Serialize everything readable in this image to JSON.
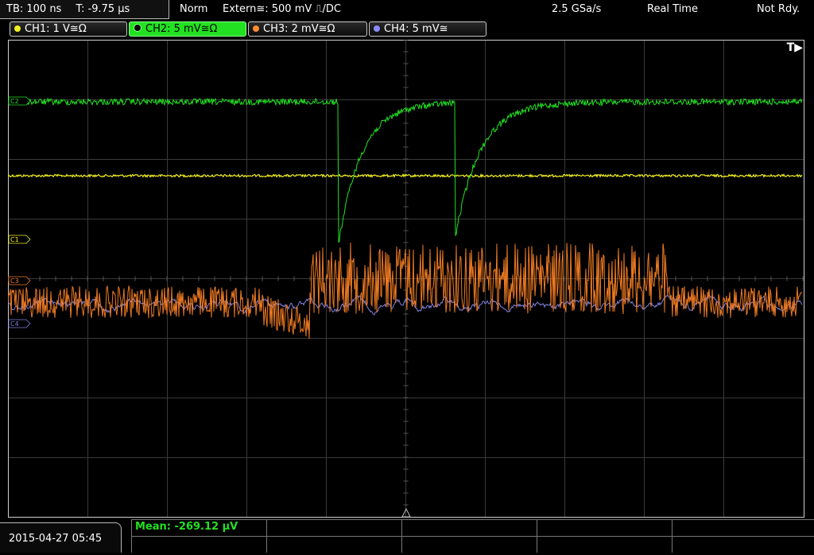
{
  "status_bar": {
    "timebase": "TB: 100 ns",
    "trigger_time": "T: -9.75 µs",
    "trigger_mode": "Norm",
    "trigger_source": "Extern≅: 500 mV ⎍/DC",
    "sample_rate": "2.5 GSa/s",
    "acq_mode": "Real Time",
    "state": "Not Rdy."
  },
  "channels": [
    {
      "label": "CH1: 1 V≅Ω",
      "color": "#f0f020",
      "active": false
    },
    {
      "label": "CH2: 5 mV≅Ω",
      "color": "#22e022",
      "active": true
    },
    {
      "label": "CH3: 2 mV≅Ω",
      "color": "#ff8c30",
      "active": false
    },
    {
      "label": "CH4: 5 mV≅",
      "color": "#8a8aff",
      "active": false
    }
  ],
  "markers": {
    "c1": "C1",
    "c2": "C2",
    "c3": "C3",
    "c4": "C4",
    "trigger": "T▶"
  },
  "colors": {
    "ch1": "#f0f020",
    "ch2": "#22e022",
    "ch3": "#ee7a22",
    "ch4": "#7f7fdd",
    "grid": "#3a3a3a",
    "frame": "#cfcfcf"
  },
  "measurement": {
    "mean": "Mean: -269.12 µV"
  },
  "footer": {
    "datetime": "2015-04-27 05:45"
  }
}
